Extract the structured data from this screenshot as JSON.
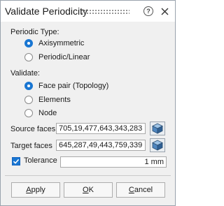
{
  "dialog": {
    "title": "Validate Periodicity",
    "icons": {
      "help": "help-icon",
      "close": "close-icon",
      "grip": "drag-grip-icon"
    }
  },
  "periodic_type": {
    "label": "Periodic Type:",
    "options": [
      {
        "label": "Axisymmetric",
        "selected": true
      },
      {
        "label": "Periodic/Linear",
        "selected": false
      }
    ]
  },
  "validate": {
    "label": "Validate:",
    "options": [
      {
        "label": "Face pair (Topology)",
        "selected": true
      },
      {
        "label": "Elements",
        "selected": false
      },
      {
        "label": "Node",
        "selected": false
      }
    ]
  },
  "source_faces": {
    "label": "Source faces",
    "value": "705,19,477,643,343,283",
    "pick_icon": "select-cube-icon"
  },
  "target_faces": {
    "label": "Target faces",
    "value": "645,287,49,443,759,339",
    "pick_icon": "select-cube-icon"
  },
  "tolerance": {
    "label": "Tolerance",
    "checked": true,
    "value": "1 mm"
  },
  "buttons": {
    "apply": {
      "mnemonic": "A",
      "rest": "pply"
    },
    "ok": {
      "mnemonic": "O",
      "rest": "K"
    },
    "cancel": {
      "mnemonic": "C",
      "rest": "ancel"
    }
  },
  "colors": {
    "accent": "#1976d2",
    "panel": "#f0f0f0",
    "titlebar": "#ffffff"
  }
}
